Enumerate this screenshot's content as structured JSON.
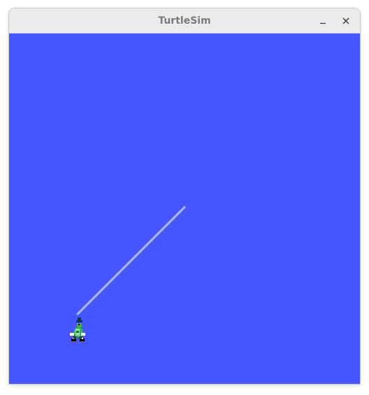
{
  "window": {
    "title": "TurtleSim",
    "minimize_icon": "minimize-icon",
    "close_icon": "close-icon"
  },
  "sim": {
    "background_color": "#4556ff",
    "pen_color": "#b3b8ff",
    "turtle_icon": "turtle-icon"
  }
}
